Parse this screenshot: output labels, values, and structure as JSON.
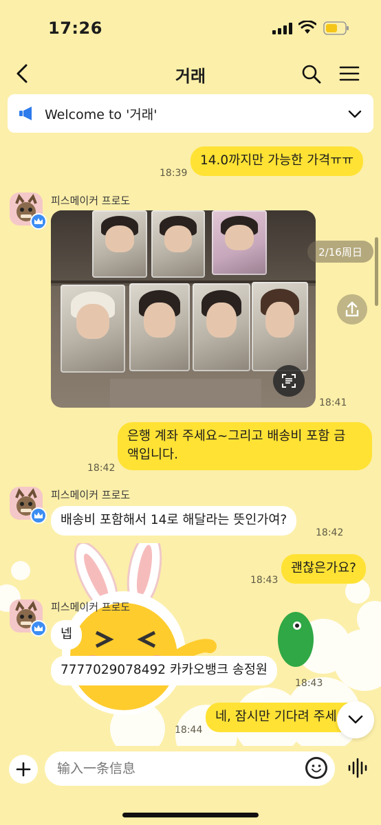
{
  "status_bar": {
    "time": "17:26"
  },
  "header": {
    "title": "거래"
  },
  "notice": {
    "text": "Welcome to '거래'"
  },
  "date_pill": "2/16周日",
  "messages": [
    {
      "id": "m1",
      "side": "mine",
      "text": "14.0까지만 가능한 가격ㅠㅠ",
      "time": "18:39"
    },
    {
      "id": "m2",
      "side": "theirs",
      "sender": "피스메이커 프로도",
      "type": "photo",
      "time": "18:41"
    },
    {
      "id": "m3",
      "side": "mine",
      "lines": [
        "은행 계좌 주세요~그리고 배송비 포함 금",
        "액입니다."
      ],
      "time": "18:42"
    },
    {
      "id": "m4",
      "side": "theirs",
      "sender": "피스메이커 프로도",
      "text": "배송비 포함해서 14로 해달라는 뜻인가여?",
      "time": "18:42"
    },
    {
      "id": "m5",
      "side": "mine",
      "text": "괜찮은가요?",
      "time": "18:43"
    },
    {
      "id": "m6",
      "side": "theirs",
      "sender": "피스메이커 프로도",
      "text": "넵"
    },
    {
      "id": "m7",
      "side": "theirs",
      "text": "7777029078492 카카오뱅크 송정원",
      "time": "18:43"
    },
    {
      "id": "m8",
      "side": "mine",
      "text": "네, 잠시만 기다려 주세요",
      "time": "18:44"
    }
  ],
  "input": {
    "placeholder": "输入一条信息"
  },
  "icons": {
    "back": "chevron-left-icon",
    "search": "search-icon",
    "menu": "menu-icon",
    "notice": "megaphone-icon",
    "expand": "chevron-down-icon",
    "share": "share-icon",
    "scan": "text-scan-icon",
    "plus": "plus-icon",
    "emoji": "emoji-icon",
    "voice": "voice-icon"
  },
  "colors": {
    "background": "#FCEFA9",
    "my_bubble": "#FFE234",
    "their_bubble": "#FFFFFF",
    "accent_blue": "#3C8DF3"
  }
}
